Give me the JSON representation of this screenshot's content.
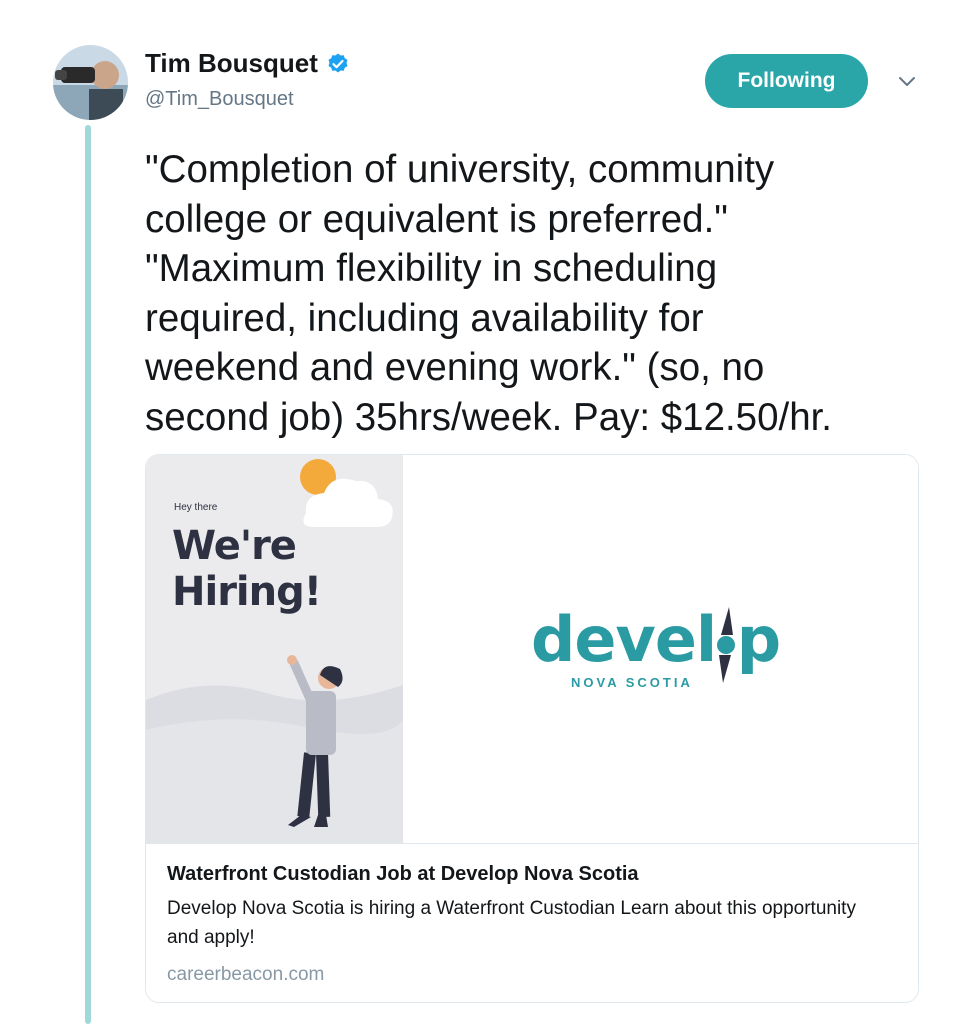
{
  "tweet": {
    "author_name": "Tim Bousquet",
    "author_handle": "@Tim_Bousquet",
    "follow_label": "Following",
    "text": "\"Completion of university, community\ncollege or equivalent is preferred.\"\n\"Maximum flexibility in scheduling\nrequired, including availability for\nweekend and evening work.\" (so, no\nsecond job) 35hrs/week. Pay: $12.50/hr.",
    "icons": [
      "verified-badge-icon",
      "chevron-down-icon"
    ],
    "colors": {
      "accent": "#2aa6a9",
      "thread_line": "#9fd9dc",
      "verified": "#1da1f2"
    }
  },
  "card": {
    "image_text": {
      "hey": "Hey there",
      "line1": "We're",
      "line2": "Hiring!"
    },
    "logo_word": "devel p",
    "logo_sub": "NOVA SCOTIA",
    "title": "Waterfront Custodian Job at Develop Nova Scotia",
    "description": "Develop Nova Scotia is hiring a Waterfront Custodian Learn about this opportunity and apply!",
    "domain": "careerbeacon.com",
    "colors": {
      "brand": "#2a9ba3",
      "sun": "#f4a93b"
    }
  }
}
